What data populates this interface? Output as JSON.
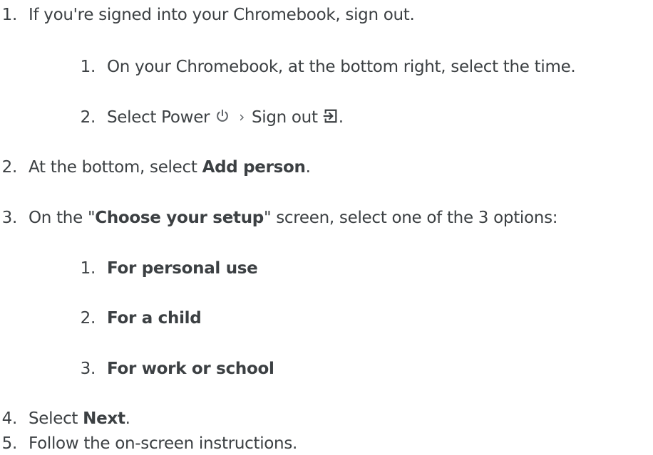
{
  "steps": [
    {
      "num": "1.",
      "text": "If you're signed into your Chromebook, sign out.",
      "substeps": [
        {
          "num": "1.",
          "text": "On your Chromebook, at the bottom right, select the time."
        },
        {
          "num": "2.",
          "text_before": "Select Power",
          "power_icon": "power-icon",
          "separator": "›",
          "text_middle": "Sign out",
          "signout_icon": "sign-out-icon",
          "text_after": "."
        }
      ]
    },
    {
      "num": "2.",
      "text_before": "At the bottom, select ",
      "bold": "Add person",
      "text_after": "."
    },
    {
      "num": "3.",
      "text_before": "On the \"",
      "bold": "Choose your setup",
      "text_after": "\" screen, select one of the 3 options:",
      "substeps": [
        {
          "num": "1.",
          "bold": "For personal use"
        },
        {
          "num": "2.",
          "bold": "For a child"
        },
        {
          "num": "3.",
          "bold": "For work or school"
        }
      ]
    },
    {
      "num": "4.",
      "text_before": "Select ",
      "bold": "Next",
      "text_after": "."
    },
    {
      "num": "5.",
      "text": "Follow the on-screen instructions."
    }
  ]
}
